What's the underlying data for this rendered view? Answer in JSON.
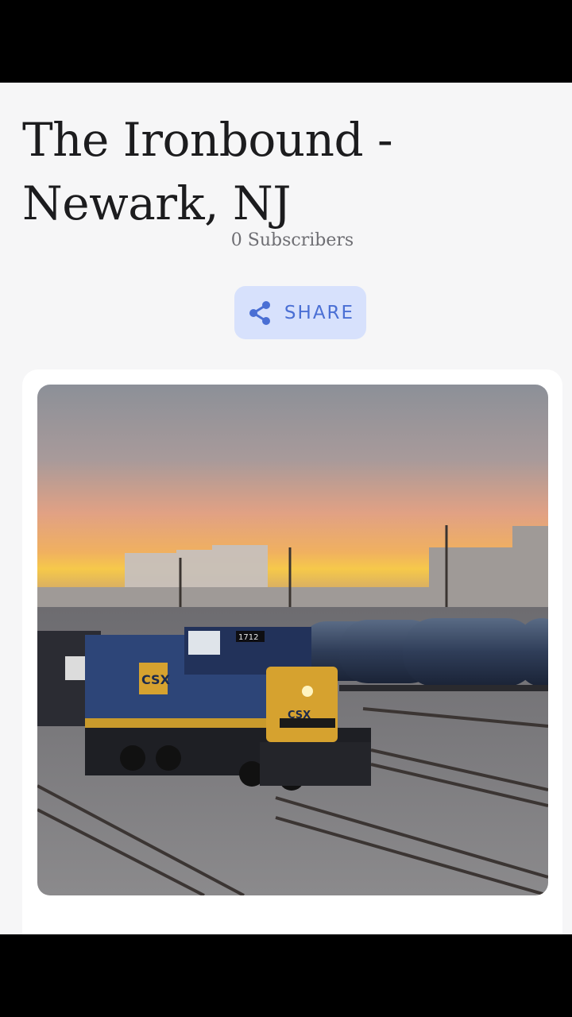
{
  "page": {
    "title": "The Ironbound - Newark, NJ",
    "subscribers": "0 Subscribers"
  },
  "share": {
    "label": "SHARE",
    "icon": "share-icon"
  },
  "photo": {
    "labels": {
      "railroad_mark": "CSX",
      "number_board": "1712"
    }
  },
  "colors": {
    "background": "#f6f6f7",
    "share_bg": "#d7e1fc",
    "share_accent": "#4a6fd4",
    "title_text": "#1c1c1e",
    "subtitle_text": "#6e6e73"
  }
}
